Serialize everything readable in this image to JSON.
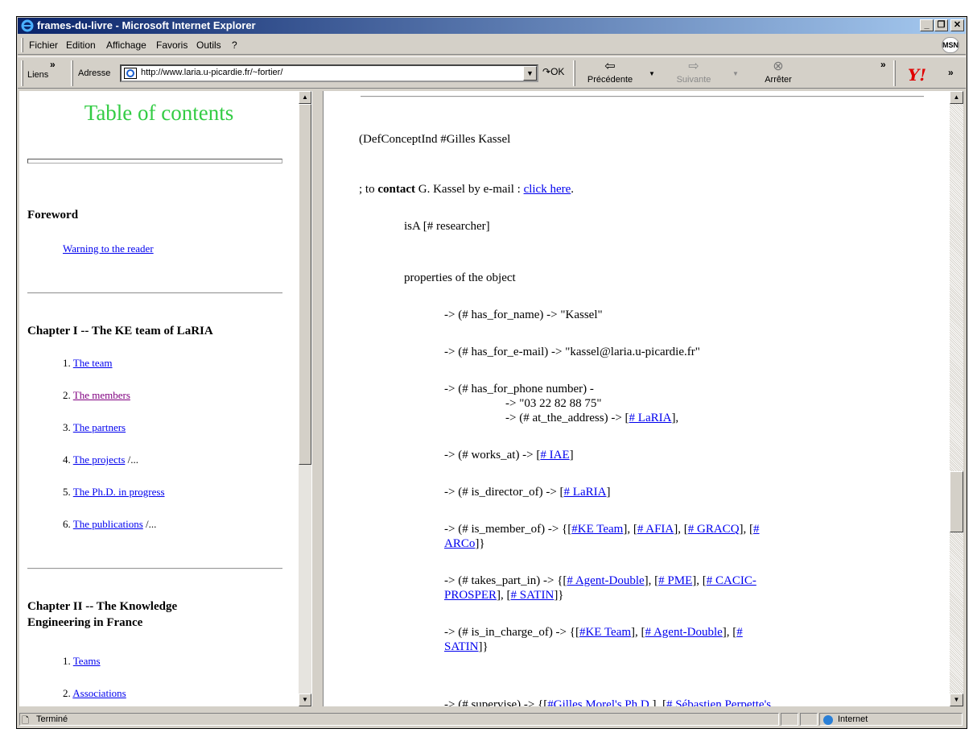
{
  "window": {
    "title": "frames-du-livre - Microsoft Internet Explorer"
  },
  "menu": {
    "items": [
      "Fichier",
      "Edition",
      "Affichage",
      "Favoris",
      "Outils",
      "?"
    ],
    "msn_label": "MSN"
  },
  "address_bar": {
    "links_label": "Liens",
    "address_label": "Adresse",
    "url": "http://www.laria.u-picardie.fr/~fortier/",
    "go_label": "OK"
  },
  "nav": {
    "back": "Précédente",
    "forward": "Suivante",
    "stop": "Arrêter"
  },
  "left_frame": {
    "title": "Table of contents",
    "foreword": {
      "heading": "Foreword",
      "link": "Warning to the reader"
    },
    "chapter1": {
      "heading": "Chapter I -- The KE team of LaRIA",
      "items": [
        {
          "num": "1. ",
          "link": "The team",
          "suffix": ""
        },
        {
          "num": "2. ",
          "link": "The members",
          "suffix": ""
        },
        {
          "num": "3. ",
          "link": "The partners",
          "suffix": ""
        },
        {
          "num": "4. ",
          "link": "The projects",
          "suffix": " /..."
        },
        {
          "num": "5. ",
          "link": "The Ph.D. in progress",
          "suffix": ""
        },
        {
          "num": "6. ",
          "link": "The publications",
          "suffix": " /..."
        }
      ]
    },
    "chapter2": {
      "heading_line1": "Chapter II -- The Knowledge",
      "heading_line2": "Engineering in France",
      "items": [
        {
          "num": "1. ",
          "link": "Teams"
        },
        {
          "num": "2. ",
          "link": "Associations"
        }
      ]
    }
  },
  "right_frame": {
    "def": "(DefConceptInd  #Gilles Kassel",
    "contact": {
      "pre": "; to ",
      "bold": "contact",
      "mid": " G. Kassel by e-mail : ",
      "link": "click here",
      "post": "."
    },
    "isa": "isA [# researcher]",
    "props": "properties of the object",
    "name": "-> (# has_for_name) -> \"Kassel\"",
    "email": "-> (# has_for_e-mail) -> \"kassel@laria.u-picardie.fr\"",
    "phone1": "-> (# has_for_phone number) -",
    "phone2": "-> \"03 22 82 88 75\"",
    "phone3_pre": "-> (# at_the_address) -> [",
    "phone3_link": "# LaRIA",
    "phone3_post": "],",
    "works_pre": "-> (# works_at) -> [",
    "works_link": "# IAE",
    "works_post": "]",
    "director_pre": "-> (# is_director_of) -> [",
    "director_link": "# LaRIA",
    "director_post": "]",
    "member_pre": "-> (# is_member_of) -> {[",
    "member_l1": "#KE Team",
    "member_s1": "], [",
    "member_l2": "# AFIA",
    "member_s2": "], [",
    "member_l3": "# GRACQ",
    "member_s3": "], [",
    "member_l4a": "#",
    "member_l4b": "ARCo",
    "member_post": "]}",
    "takes_pre": "-> (# takes_part_in) -> {[",
    "takes_l1": "# Agent-Double",
    "takes_s1": "], [",
    "takes_l2": "# PME",
    "takes_s2": "], [",
    "takes_l3a": "# CACIC-",
    "takes_l3b": "PROSPER",
    "takes_s3": "], [",
    "takes_l4": "# SATIN",
    "takes_post": "]}",
    "charge_pre": "-> (# is_in_charge_of) -> {[",
    "charge_l1": "#KE Team",
    "charge_s1": "], [",
    "charge_l2": "# Agent-Double",
    "charge_s2": "], [",
    "charge_l3a": "#",
    "charge_l3b": "SATIN",
    "charge_post": "]}",
    "supervise_pre": "-> (# supervise) -> {[",
    "supervise_l1": "#Gilles Morel's Ph.D.",
    "supervise_s1": "], [",
    "supervise_l2": "# Sébastien Perpette's"
  },
  "status": {
    "text": "Terminé",
    "zone": "Internet"
  }
}
